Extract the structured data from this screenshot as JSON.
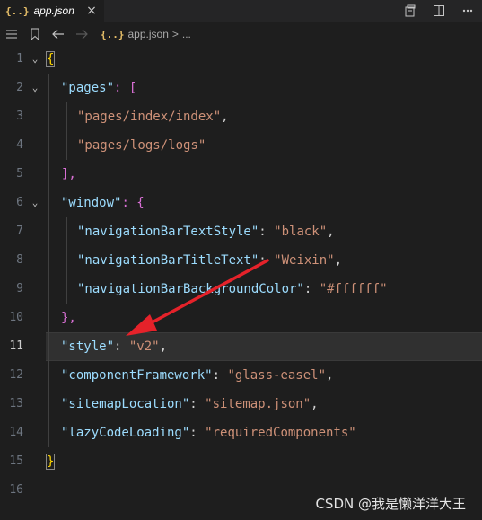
{
  "tab": {
    "icon": "{..}",
    "label": "app.json",
    "close": "×"
  },
  "actions": {
    "open_preview": "open-preview-icon",
    "split": "split-editor-icon",
    "more": "more-icon"
  },
  "breadcrumb": {
    "icon": "{..}",
    "file": "app.json",
    "sep": ">",
    "more": "..."
  },
  "colors": {
    "key": "#9cdcfe",
    "string": "#ce9178",
    "brace": "#ffd700",
    "bracket": "#da70d6",
    "arrow": "#e5222a"
  },
  "lines": [
    {
      "n": "1",
      "text": "{"
    },
    {
      "n": "2",
      "key": "\"pages\"",
      "tail": ": ["
    },
    {
      "n": "3",
      "str": "\"pages/index/index\"",
      "tail": ","
    },
    {
      "n": "4",
      "str": "\"pages/logs/logs\""
    },
    {
      "n": "5",
      "text": "],"
    },
    {
      "n": "6",
      "key": "\"window\"",
      "tail": ": {"
    },
    {
      "n": "7",
      "key": "\"navigationBarTextStyle\"",
      "mid": ": ",
      "str": "\"black\"",
      "tail": ","
    },
    {
      "n": "8",
      "key": "\"navigationBarTitleText\"",
      "mid": ": ",
      "str": "\"Weixin\"",
      "tail": ","
    },
    {
      "n": "9",
      "key": "\"navigationBarBackgroundColor\"",
      "mid": ": ",
      "str": "\"#ffffff\""
    },
    {
      "n": "10",
      "text": "},"
    },
    {
      "n": "11",
      "key": "\"style\"",
      "mid": ": ",
      "str": "\"v2\"",
      "tail": ","
    },
    {
      "n": "12",
      "key": "\"componentFramework\"",
      "mid": ": ",
      "str": "\"glass-easel\"",
      "tail": ","
    },
    {
      "n": "13",
      "key": "\"sitemapLocation\"",
      "mid": ": ",
      "str": "\"sitemap.json\"",
      "tail": ","
    },
    {
      "n": "14",
      "key": "\"lazyCodeLoading\"",
      "mid": ": ",
      "str": "\"requiredComponents\""
    },
    {
      "n": "15",
      "text": "}"
    },
    {
      "n": "16",
      "text": ""
    }
  ],
  "watermark": "CSDN @我是懒洋洋大王"
}
